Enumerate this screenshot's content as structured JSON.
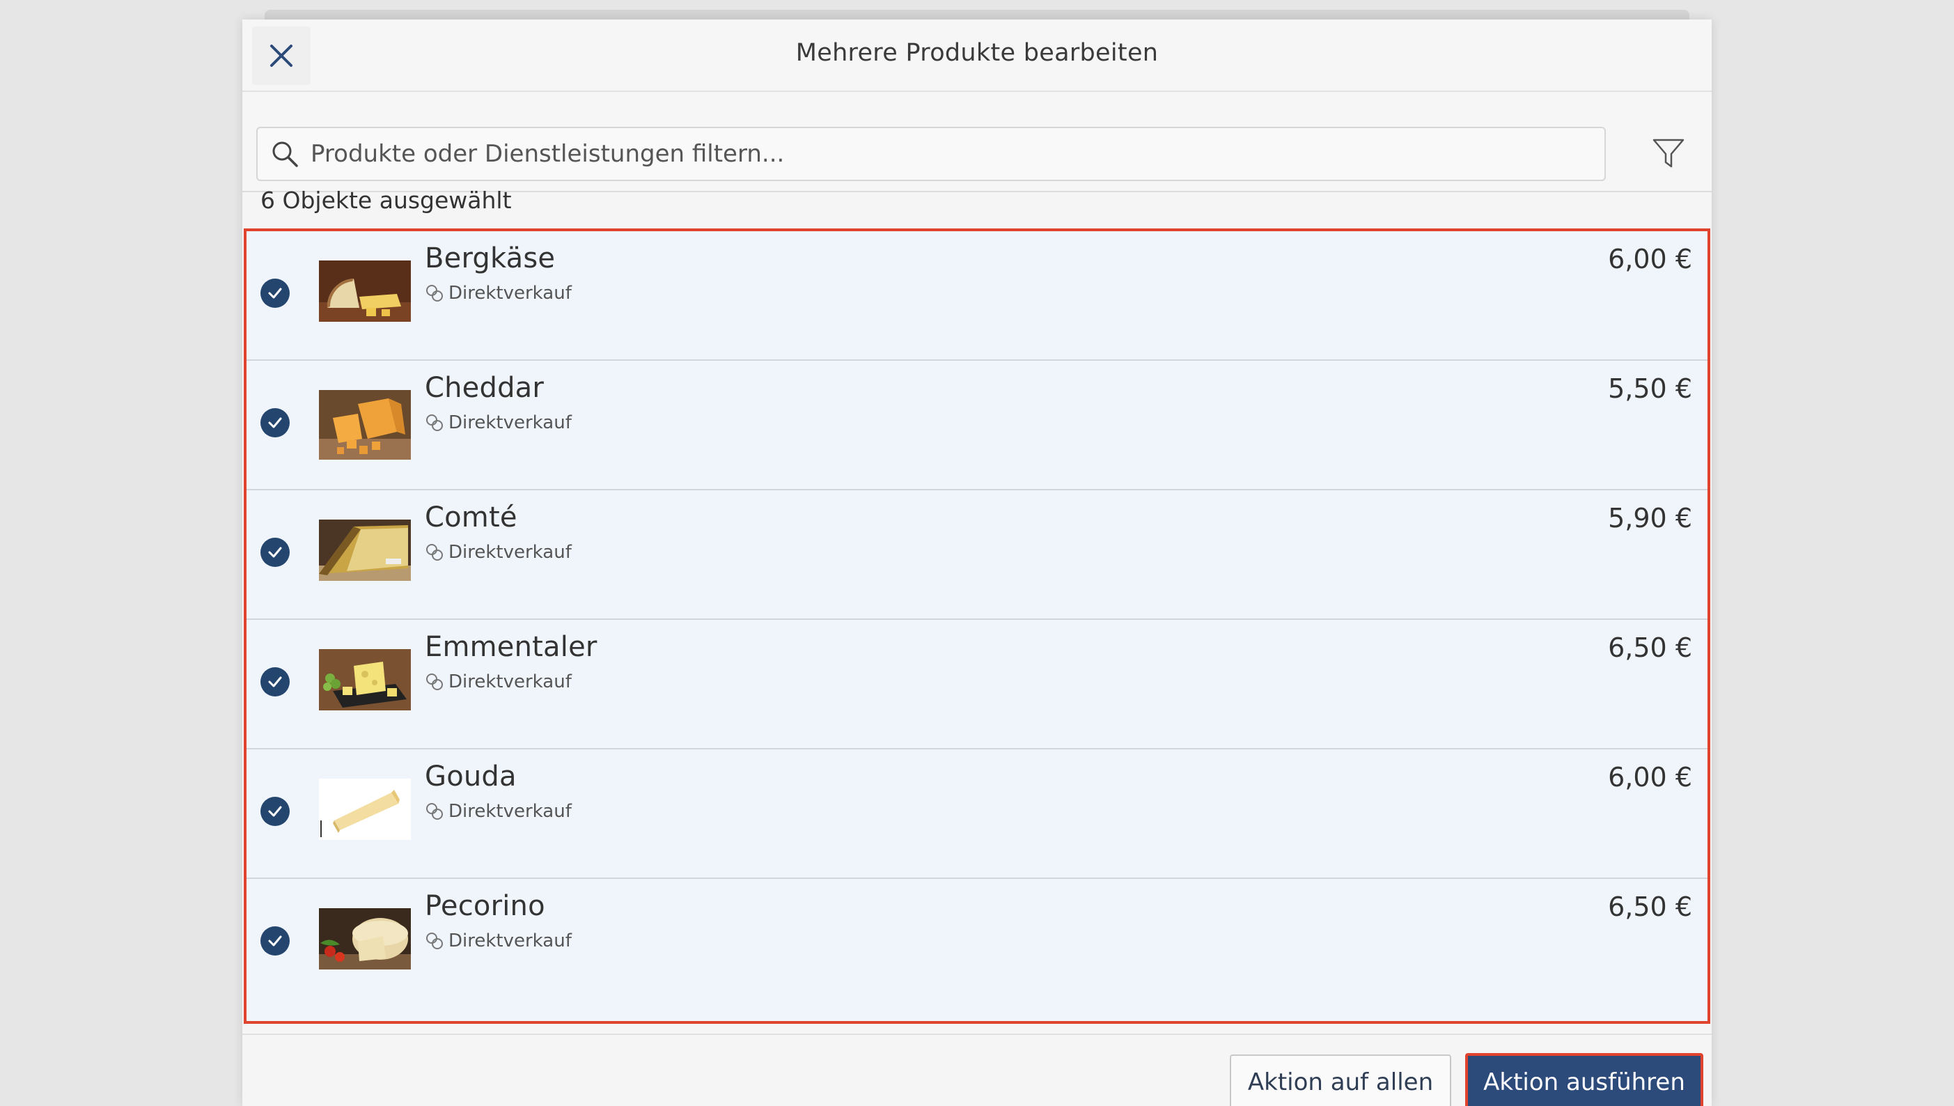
{
  "header": {
    "title": "Mehrere Produkte bearbeiten",
    "close_icon": "close-icon"
  },
  "search": {
    "placeholder": "Produkte oder Dienstleistungen filtern...",
    "value": "",
    "filter_icon": "filter-icon"
  },
  "selection": {
    "text": "6 Objekte ausgewählt"
  },
  "products": [
    {
      "name": "Bergkäse",
      "category": "Direktverkauf",
      "price": "6,00 €",
      "selected": true
    },
    {
      "name": "Cheddar",
      "category": "Direktverkauf",
      "price": "5,50 €",
      "selected": true
    },
    {
      "name": "Comté",
      "category": "Direktverkauf",
      "price": "5,90 €",
      "selected": true
    },
    {
      "name": "Emmentaler",
      "category": "Direktverkauf",
      "price": "6,50 €",
      "selected": true
    },
    {
      "name": "Gouda",
      "category": "Direktverkauf",
      "price": "6,00 €",
      "selected": true
    },
    {
      "name": "Pecorino",
      "category": "Direktverkauf",
      "price": "6,50 €",
      "selected": true
    }
  ],
  "footer": {
    "all_label": "Aktion auf allen",
    "execute_label": "Aktion ausführen"
  },
  "colors": {
    "accent": "#2c4a7a",
    "check": "#24456e",
    "highlight": "#e0442e",
    "row_bg": "#f0f5fc"
  }
}
